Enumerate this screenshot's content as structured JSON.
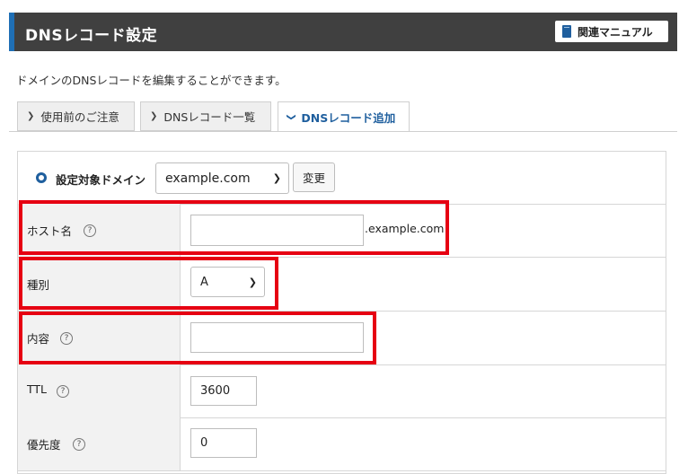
{
  "header": {
    "title": "DNSレコード設定",
    "manual_label": "関連マニュアル"
  },
  "description": "ドメインのDNSレコードを編集することができます。",
  "tabs": [
    {
      "label": "使用前のご注意",
      "active": false
    },
    {
      "label": "DNSレコード一覧",
      "active": false
    },
    {
      "label": "DNSレコード追加",
      "active": true
    }
  ],
  "domain": {
    "label": "設定対象ドメイン",
    "selected": "example.com",
    "change_label": "変更"
  },
  "form": {
    "host": {
      "label": "ホスト名",
      "value": "",
      "suffix": ".example.com"
    },
    "type": {
      "label": "種別",
      "selected": "A"
    },
    "content": {
      "label": "内容",
      "value": ""
    },
    "ttl": {
      "label": "TTL",
      "value": "3600"
    },
    "priority": {
      "label": "優先度",
      "value": "0"
    }
  },
  "help_glyph": "?",
  "colors": {
    "header_bg": "#404040",
    "accent": "#1f5f9e",
    "highlight": "#e60012"
  }
}
